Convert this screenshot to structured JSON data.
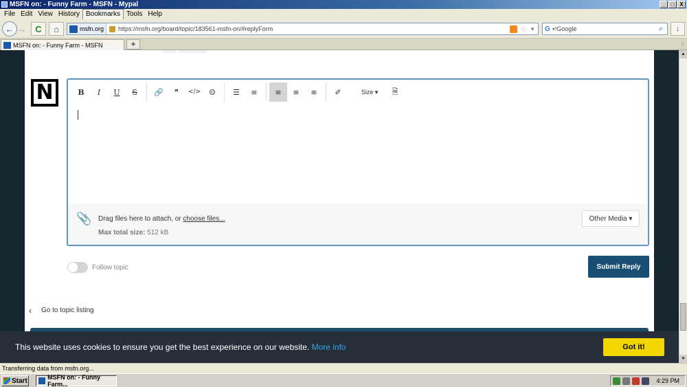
{
  "window": {
    "title": "MSFN on: - Funny Farm - MSFN - Mypal",
    "min": "_",
    "max": "□",
    "close": "X"
  },
  "menu": [
    "File",
    "Edit",
    "View",
    "History",
    "Bookmarks",
    "Tools",
    "Help"
  ],
  "nav": {
    "back": "←",
    "forward": "→",
    "reload": "C",
    "home": "⌂",
    "site_identity": "msfn.org",
    "url": "https://msfn.org/board/topic/183561-msfn-on/#replyForm",
    "search_engine_icon": "G",
    "search_placeholder": "!Google",
    "search_glass": "⌕",
    "download": "↓"
  },
  "tab": {
    "title": "MSFN on: - Funny Farm - MSFN",
    "new_tab": "+",
    "list": "::"
  },
  "editor": {
    "avatar_letter": "N",
    "toolbar": {
      "bold": "B",
      "italic": "I",
      "underline": "U",
      "strike": "S",
      "link": "🔗",
      "quote": "❞",
      "code": "</>",
      "emoji": "☺",
      "bullets": "☰",
      "numbers": "≡",
      "align_left": "≡",
      "align_center": "≡",
      "align_right": "≡",
      "color": "✐",
      "size_label": "Size ▾",
      "source": "🗎"
    },
    "attach_text": "Drag files here to attach, or ",
    "attach_link": "choose files...",
    "max_label": "Max total size: ",
    "max_value": "512 kB",
    "other_media": "Other Media ▾"
  },
  "follow_label": "Follow topic",
  "submit_label": "Submit Reply",
  "goto_label": "Go to topic listing",
  "cookie": {
    "message": "This website uses cookies to ensure you get the best experience on our website. ",
    "link": "More info",
    "button": "Got it!"
  },
  "status_text": "Transferring data from msfn.org...",
  "taskbar": {
    "start": "Start",
    "task": "MSFN on: - Funny Farm...",
    "clock": "4:29 PM"
  },
  "colors": {
    "submit": "#1a4f75",
    "cookie_button": "#f1d600",
    "cookie_link": "#31a8f0",
    "editor_border": "#5d97c5"
  }
}
